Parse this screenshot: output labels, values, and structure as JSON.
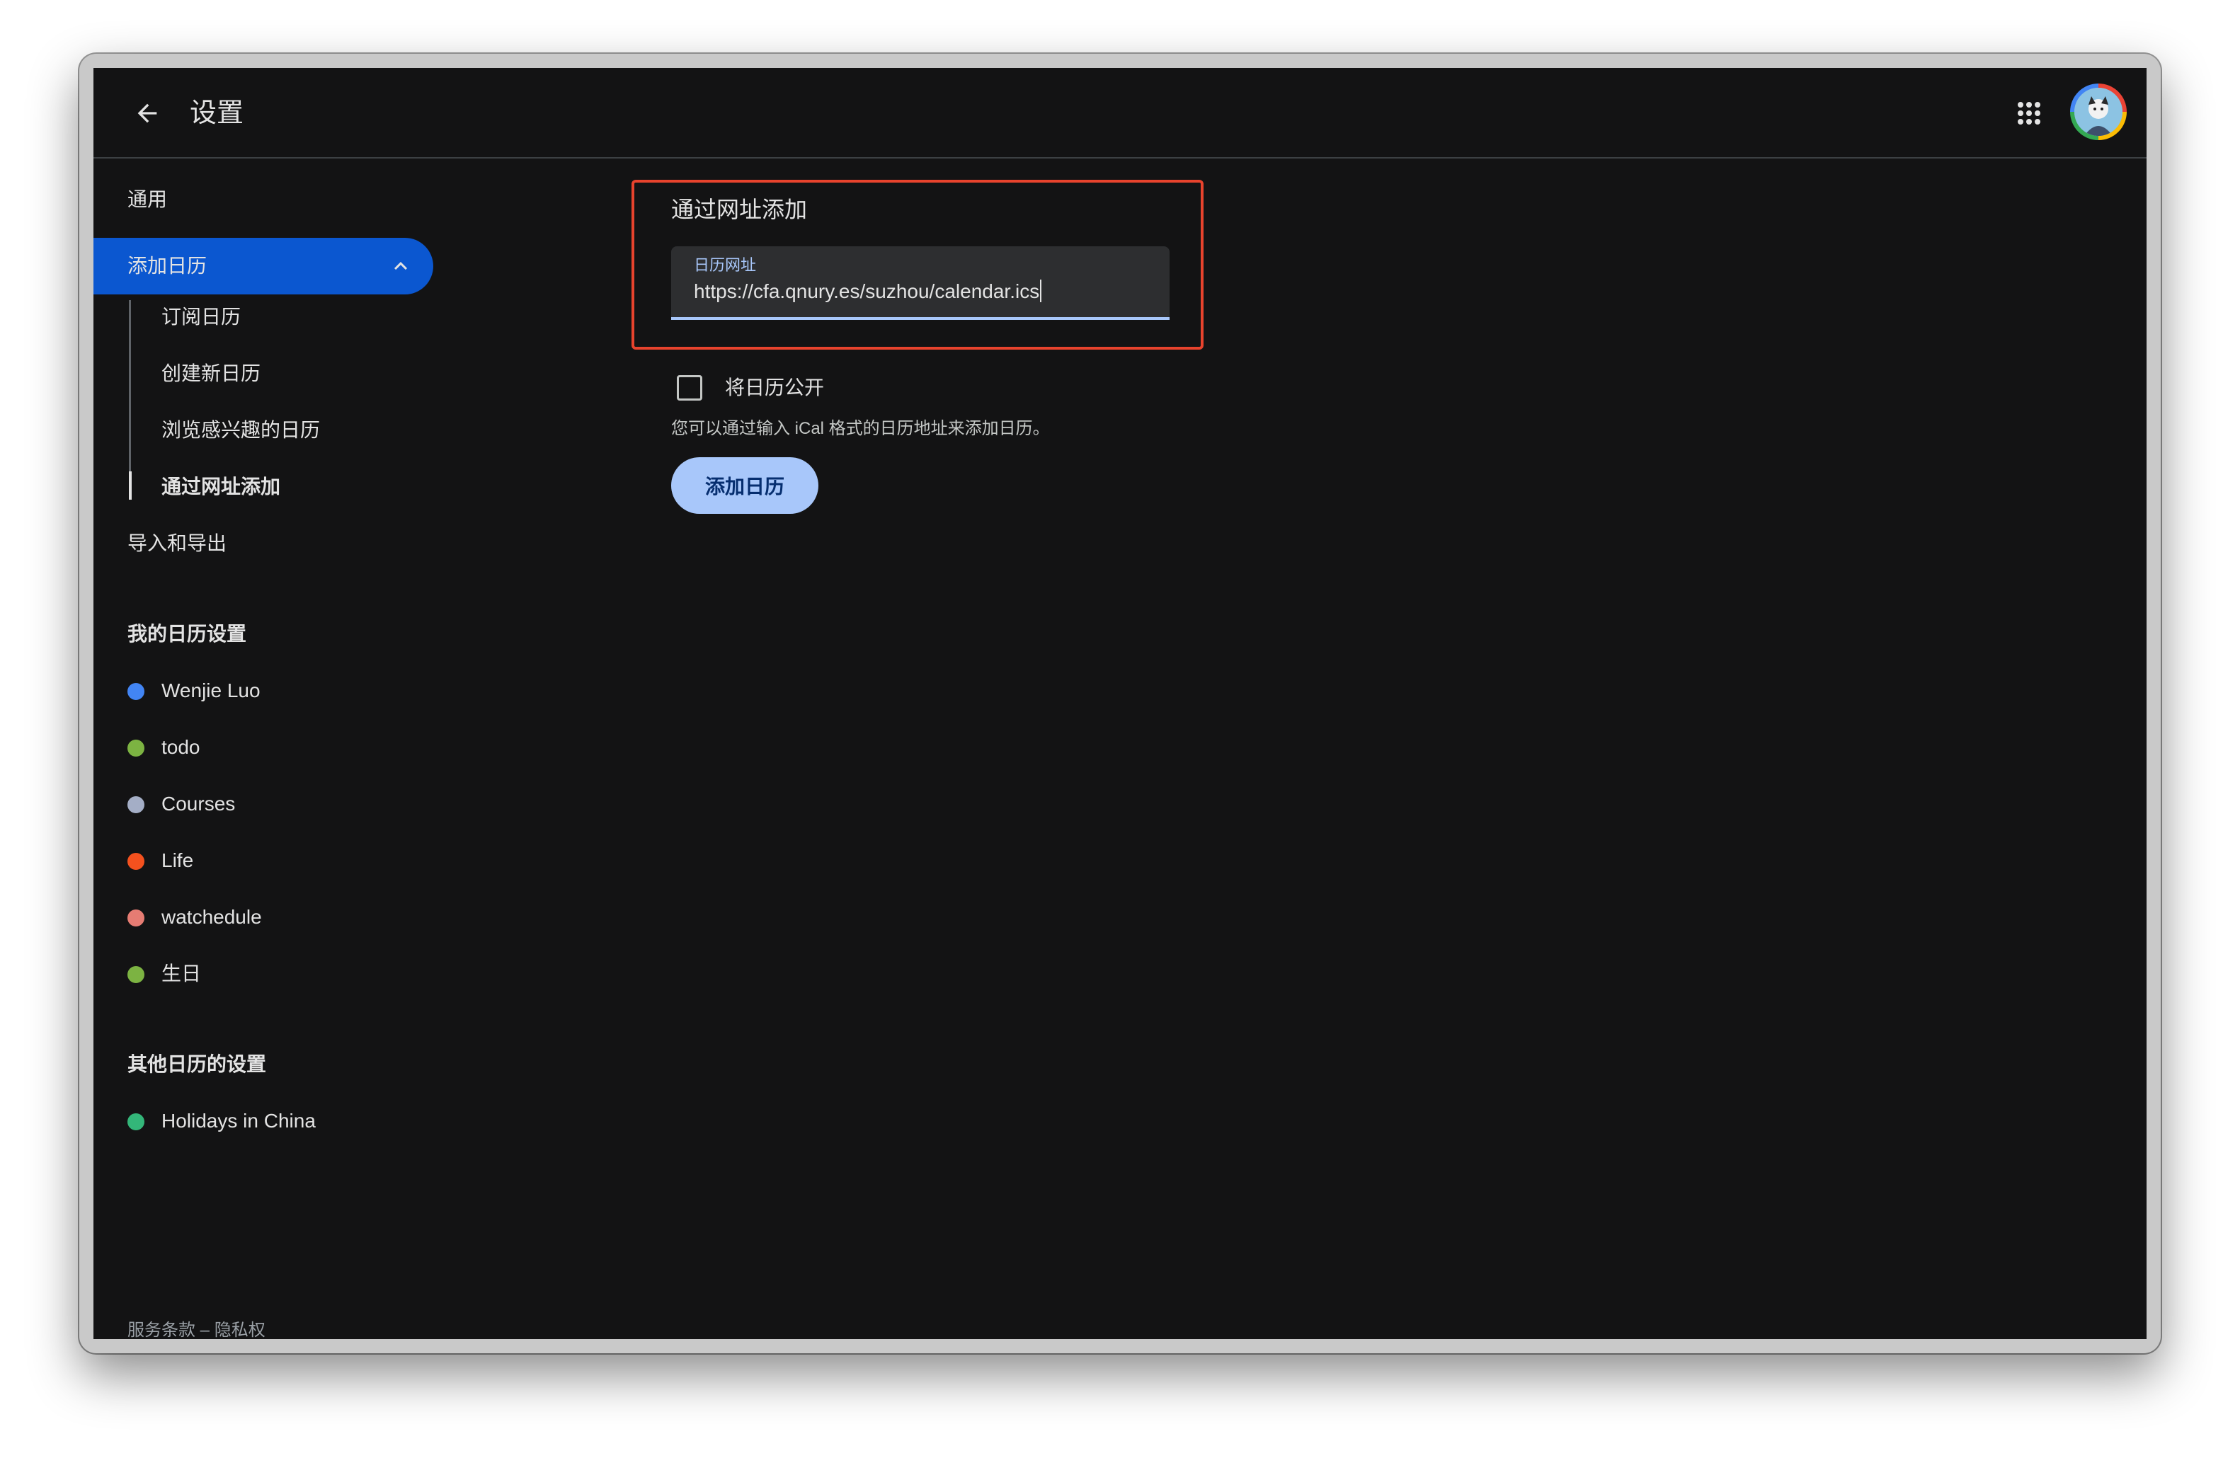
{
  "header": {
    "title": "设置",
    "back_icon": "arrow-left-icon",
    "apps_icon": "apps-grid-icon",
    "avatar_icon": "user-avatar"
  },
  "sidebar": {
    "general": "通用",
    "add_calendar": "添加日历",
    "sub_items": [
      "订阅日历",
      "创建新日历",
      "浏览感兴趣的日历",
      "通过网址添加"
    ],
    "import_export": "导入和导出",
    "my_calendars_title": "我的日历设置",
    "my_calendars": [
      {
        "name": "Wenjie Luo",
        "color": "#4285f4"
      },
      {
        "name": "todo",
        "color": "#7cb342"
      },
      {
        "name": "Courses",
        "color": "#a4aec6"
      },
      {
        "name": "Life",
        "color": "#f4511e"
      },
      {
        "name": "watchedule",
        "color": "#e67c73"
      },
      {
        "name": "生日",
        "color": "#7cb342"
      }
    ],
    "other_calendars_title": "其他日历的设置",
    "other_calendars": [
      {
        "name": "Holidays in China",
        "color": "#33b679"
      }
    ],
    "footer": {
      "terms": "服务条款",
      "separator": "–",
      "privacy": "隐私权"
    }
  },
  "main": {
    "section_title": "通过网址添加",
    "url_field": {
      "label": "日历网址",
      "value": "https://cfa.qnury.es/suzhou/calendar.ics"
    },
    "public_checkbox": {
      "label": "将日历公开",
      "checked": false
    },
    "helper_text": "您可以通过输入 iCal 格式的日历地址来添加日历。",
    "add_button": "添加日历"
  },
  "colors": {
    "background": "#131314",
    "accent_active": "#0b57d0",
    "button": "#a8c7fa",
    "highlight_border": "#e8432d"
  }
}
